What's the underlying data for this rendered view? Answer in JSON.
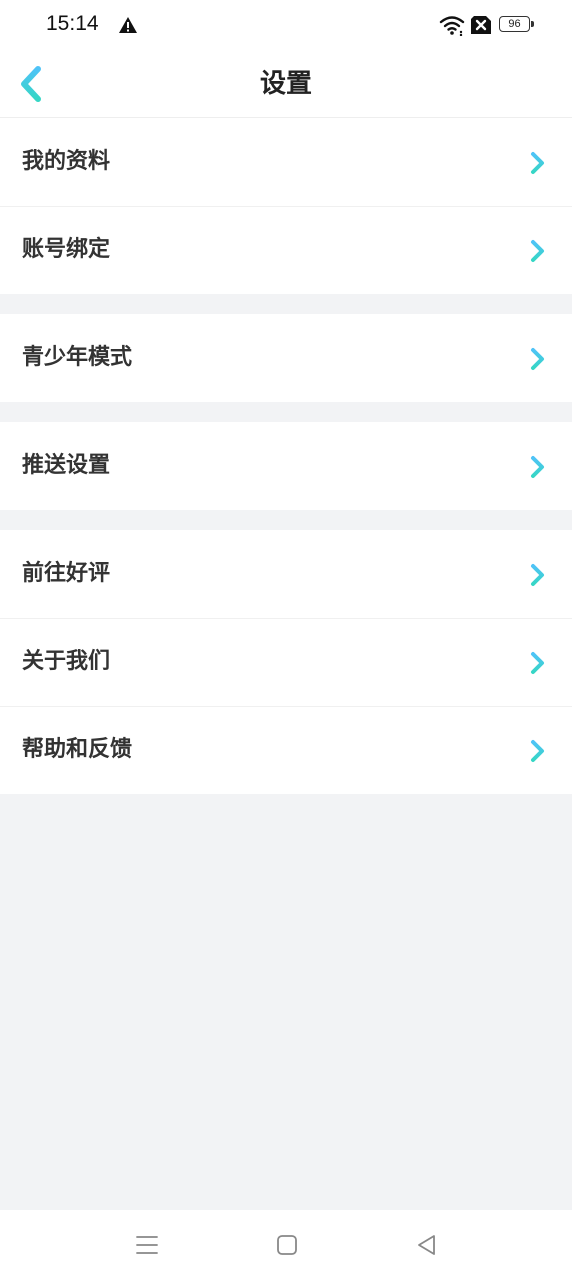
{
  "status_bar": {
    "time": "15:14",
    "battery": "96",
    "icons": [
      "warning-icon",
      "wifi-icon",
      "sim-error-icon",
      "battery-icon"
    ]
  },
  "header": {
    "title": "设置",
    "back_icon": "chevron-left-icon"
  },
  "colors": {
    "accent_gradient_start": "#4fc3f7",
    "accent_gradient_end": "#36d6c5",
    "background": "#f2f3f5",
    "text": "#333333"
  },
  "groups": [
    {
      "items": [
        {
          "label": "我的资料"
        },
        {
          "label": "账号绑定"
        }
      ]
    },
    {
      "items": [
        {
          "label": "青少年模式"
        }
      ]
    },
    {
      "items": [
        {
          "label": "推送设置"
        }
      ]
    },
    {
      "items": [
        {
          "label": "前往好评"
        },
        {
          "label": "关于我们"
        },
        {
          "label": "帮助和反馈"
        }
      ]
    }
  ],
  "nav_bar": {
    "icons": [
      "menu-icon",
      "home-icon",
      "back-icon"
    ]
  }
}
